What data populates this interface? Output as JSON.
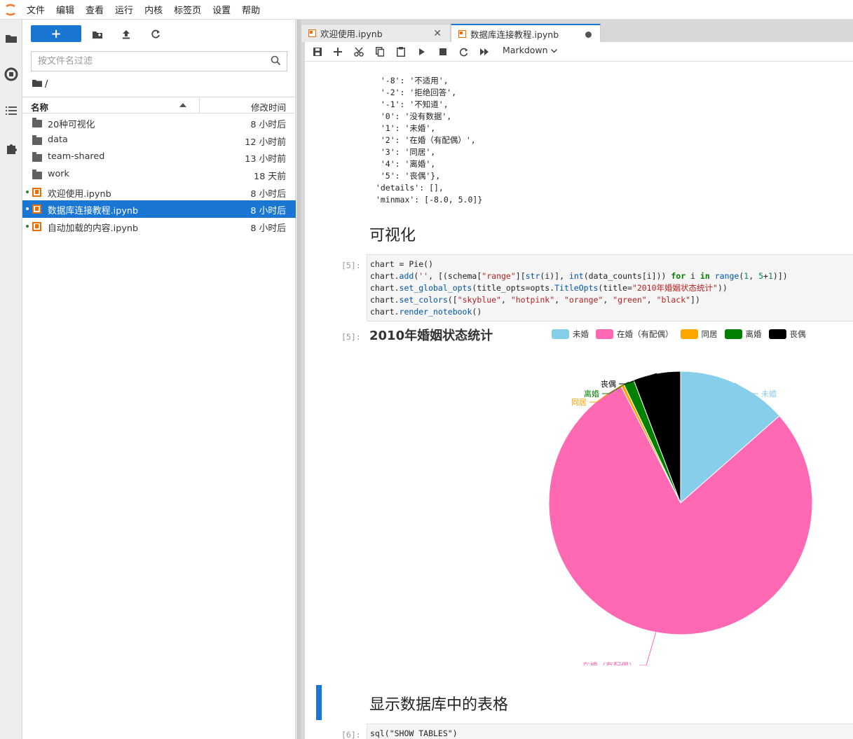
{
  "menubar": {
    "items": [
      "文件",
      "编辑",
      "查看",
      "运行",
      "内核",
      "标签页",
      "设置",
      "帮助"
    ]
  },
  "activity_bar": {
    "icons": [
      "folder-icon",
      "running-icon",
      "toc-icon",
      "extension-icon"
    ]
  },
  "file_browser": {
    "new_button_label": "+",
    "filter_placeholder": "按文件名过滤",
    "breadcrumb": "/",
    "column_name": "名称",
    "column_modified": "修改时间",
    "files": [
      {
        "name": "20种可视化",
        "modified": "8 小时后",
        "type": "folder",
        "running": false,
        "selected": false
      },
      {
        "name": "data",
        "modified": "12 小时前",
        "type": "folder",
        "running": false,
        "selected": false
      },
      {
        "name": "team-shared",
        "modified": "13 小时前",
        "type": "folder",
        "running": false,
        "selected": false
      },
      {
        "name": "work",
        "modified": "18 天前",
        "type": "folder",
        "running": false,
        "selected": false
      },
      {
        "name": "欢迎使用.ipynb",
        "modified": "8 小时后",
        "type": "notebook",
        "running": true,
        "selected": false
      },
      {
        "name": "数据库连接教程.ipynb",
        "modified": "8 小时后",
        "type": "notebook",
        "running": true,
        "selected": true
      },
      {
        "name": "自动加载的内容.ipynb",
        "modified": "8 小时后",
        "type": "notebook",
        "running": true,
        "selected": false
      }
    ]
  },
  "tabs": [
    {
      "label": "欢迎使用.ipynb",
      "active": false
    },
    {
      "label": "数据库连接教程.ipynb",
      "active": true
    }
  ],
  "notebook_toolbar": {
    "cell_type": "Markdown"
  },
  "notebook": {
    "output_top_partial": "  '-8': '不适用',",
    "output_lines": [
      "  '-2': '拒绝回答',",
      "  '-1': '不知道',",
      "  '0': '没有数据',",
      "  '1': '未婚',",
      "  '2': '在婚（有配偶）',",
      "  '3': '同居',",
      "  '4': '离婚',",
      "  '5': '丧偶'},",
      " 'details': [],",
      " 'minmax': [-8.0, 5.0]}"
    ],
    "heading_visualization": "可视化",
    "cell5_prompt": "[5]:",
    "cell5_output_prompt": "[5]:",
    "heading_tables": "显示数据库中的表格",
    "cell6_prompt": "[6]:",
    "cell6_code": "sql(\"SHOW TABLES\")"
  },
  "chart_data": {
    "type": "pie",
    "title": "2010年婚姻状态统计",
    "categories": [
      "未婚",
      "在婚（有配偶）",
      "同居",
      "离婚",
      "丧偶"
    ],
    "values": [
      13.5,
      79.0,
      0.4,
      1.3,
      5.8
    ],
    "colors": [
      "#87ceeb",
      "#ff69b4",
      "#ffa500",
      "#008000",
      "#000000"
    ],
    "legend_position": "top-right",
    "labels": [
      "未婚",
      "在婚（有配偶）",
      "同居",
      "离婚",
      "丧偶"
    ]
  }
}
